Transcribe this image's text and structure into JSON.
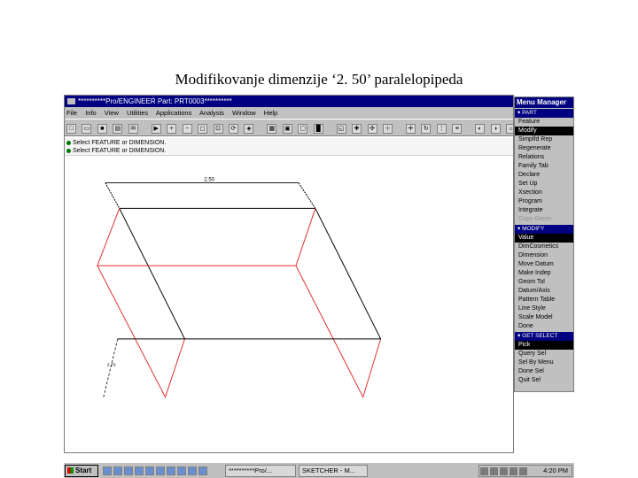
{
  "slide": {
    "title": "Modifikovanje dimenzije  ‘2. 50’  paralelopipeda"
  },
  "window": {
    "title": "**********Pro/ENGINEER Part: PRT0003**********",
    "menus": [
      "File",
      "Info",
      "View",
      "Utilities",
      "Applications",
      "Analysis",
      "Window",
      "Help"
    ],
    "messages": [
      "Select FEATURE or DIMENSION.",
      "Select FEATURE or DIMENSION."
    ],
    "dimensions": {
      "top": "2.50",
      "side": "2.70"
    }
  },
  "menu_manager": {
    "title": "Menu Manager",
    "sections": [
      {
        "name": "PART",
        "items": [
          {
            "label": "Feature",
            "state": "normal"
          },
          {
            "label": "Modify",
            "state": "selected"
          },
          {
            "label": "Simplfd Rep",
            "state": "normal"
          },
          {
            "label": "Regenerate",
            "state": "normal"
          },
          {
            "label": "Relations",
            "state": "normal"
          },
          {
            "label": "Family Tab",
            "state": "normal"
          },
          {
            "label": "Declare",
            "state": "normal"
          },
          {
            "label": "Set Up",
            "state": "normal"
          },
          {
            "label": "Xsection",
            "state": "normal"
          },
          {
            "label": "Program",
            "state": "normal"
          },
          {
            "label": "Integrate",
            "state": "normal"
          },
          {
            "label": "Copy Geom",
            "state": "disabled"
          }
        ]
      },
      {
        "name": "MODIFY",
        "items": [
          {
            "label": "Value",
            "state": "selected"
          },
          {
            "label": "DimCosmetics",
            "state": "normal"
          },
          {
            "label": "Dimension",
            "state": "normal"
          },
          {
            "label": "Move Datum",
            "state": "normal"
          },
          {
            "label": "Make Indep",
            "state": "normal"
          },
          {
            "label": "Geom Tol",
            "state": "normal"
          },
          {
            "label": "Datum/Axis",
            "state": "normal"
          },
          {
            "label": "Pattern Table",
            "state": "normal"
          },
          {
            "label": "Line Style",
            "state": "normal"
          },
          {
            "label": "Scale Model",
            "state": "normal"
          },
          {
            "label": "Done",
            "state": "normal"
          }
        ]
      },
      {
        "name": "GET SELECT",
        "items": [
          {
            "label": "Pick",
            "state": "selected"
          },
          {
            "label": "Query Sel",
            "state": "normal"
          },
          {
            "label": "Sel By Menu",
            "state": "normal"
          },
          {
            "label": "Done Sel",
            "state": "normal"
          },
          {
            "label": "Quit Sel",
            "state": "normal"
          }
        ]
      }
    ]
  },
  "taskbar": {
    "start_label": "Start",
    "tasks": [
      "**********Pro/...",
      "SKETCHER - M..."
    ],
    "clock": "4:20 PM"
  },
  "colors": {
    "edge_black": "#000000",
    "edge_red": "#e03030",
    "titlebar": "#000080"
  }
}
